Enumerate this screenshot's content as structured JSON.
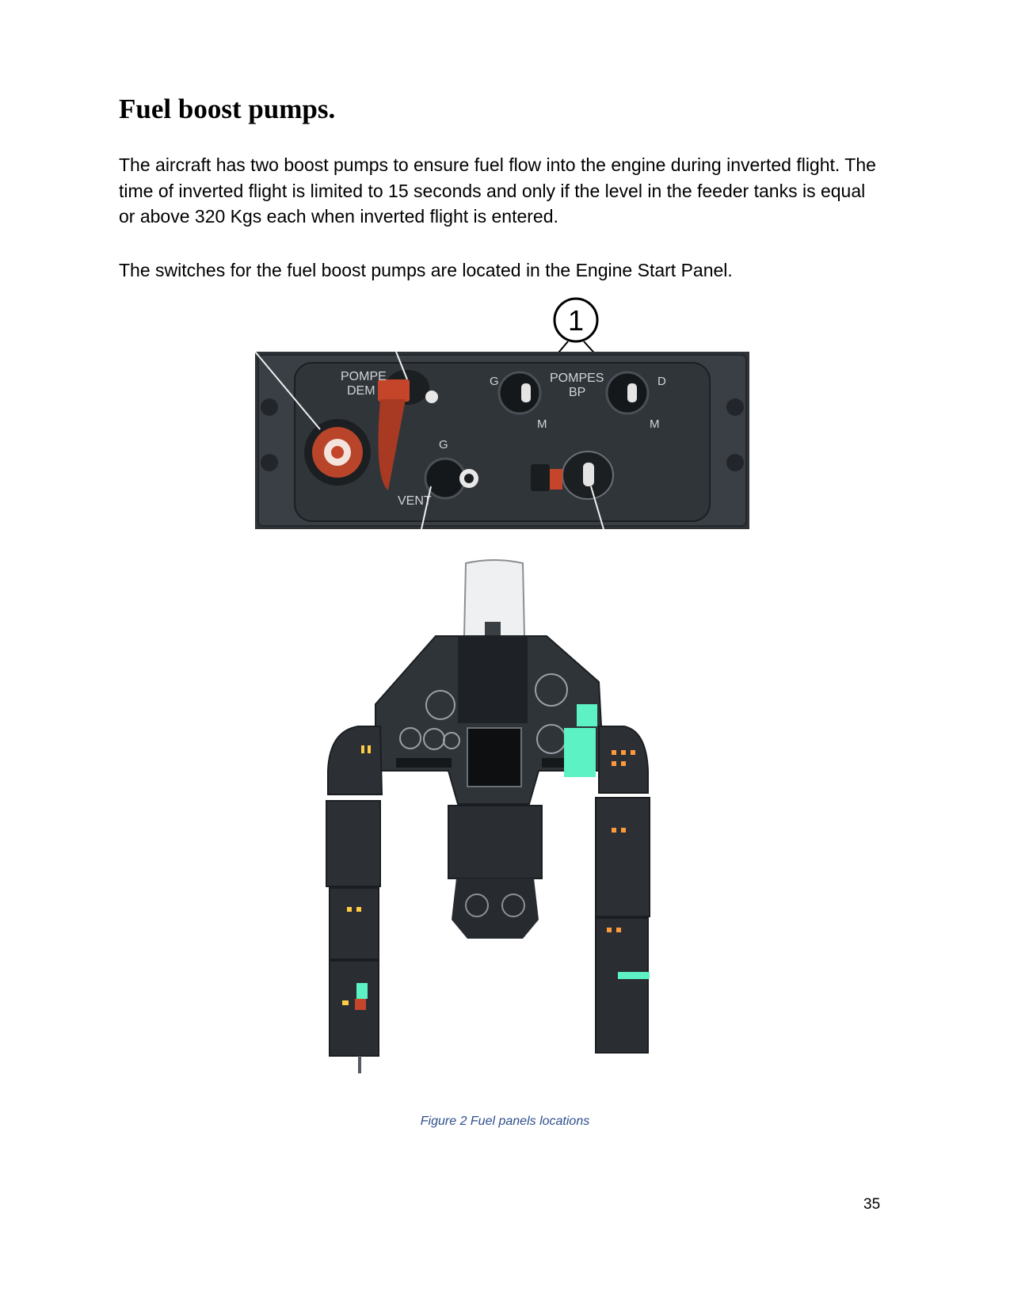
{
  "page": {
    "heading": "Fuel boost pumps.",
    "paragraph1": "The aircraft has two boost pumps to ensure fuel flow into the engine during inverted flight. The time of inverted flight is limited to 15 seconds and only if the level in the feeder tanks is equal or above 320 Kgs each when inverted flight is entered.",
    "paragraph2": "The switches for the fuel boost pumps are located in the Engine Start Panel.",
    "caption": "Figure 2 Fuel panels locations",
    "page_number": "35"
  },
  "panel_image": {
    "callout_number": "1",
    "labels": {
      "pompe": "POMPE",
      "dem": "DEM",
      "g_left": "G",
      "pompes": "POMPES",
      "bp": "BP",
      "d": "D",
      "m_left": "M",
      "m_right": "M",
      "g_vent": "G",
      "vent": "VENT"
    },
    "colors": {
      "panel": "#3a3f45",
      "switch_guard": "#c4452a",
      "highlight": "#5cf2c4"
    }
  }
}
